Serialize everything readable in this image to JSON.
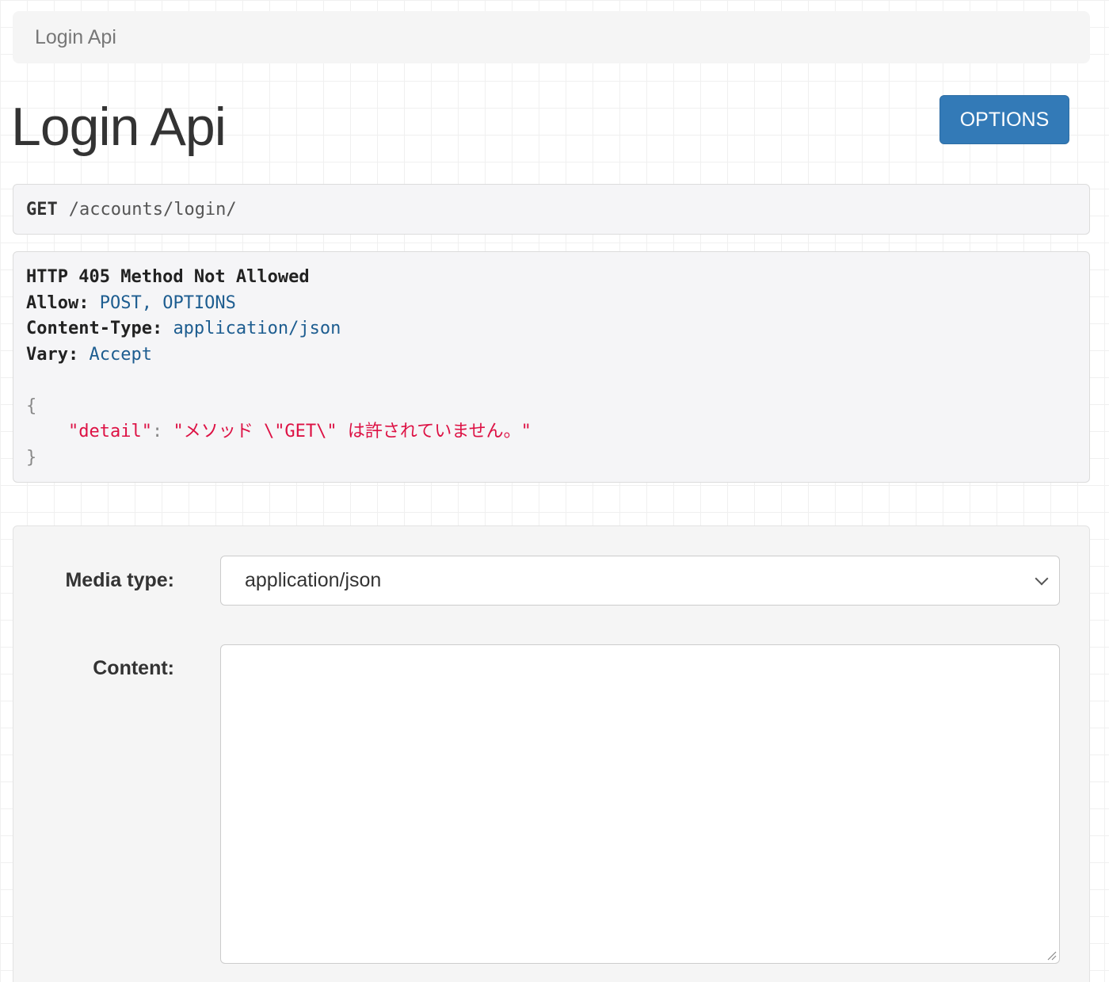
{
  "breadcrumb": {
    "current": "Login Api"
  },
  "header": {
    "title": "Login Api",
    "options_label": "OPTIONS"
  },
  "request": {
    "method": "GET",
    "url": "/accounts/login/"
  },
  "response": {
    "status": "HTTP 405 Method Not Allowed",
    "headers": [
      {
        "name": "Allow:",
        "value": "POST, OPTIONS"
      },
      {
        "name": "Content-Type:",
        "value": "application/json"
      },
      {
        "name": "Vary:",
        "value": "Accept"
      }
    ],
    "body": {
      "open_brace": "{",
      "key": "\"detail\"",
      "colon": ": ",
      "value": "\"メソッド \\\"GET\\\" は許されていません。\"",
      "close_brace": "}"
    }
  },
  "form": {
    "media_type_label": "Media type:",
    "media_type_value": "application/json",
    "content_label": "Content:",
    "content_value": ""
  },
  "colors": {
    "primary_button": "#337ab7",
    "header_value": "#1d5d90",
    "json_string": "#dd1144"
  }
}
